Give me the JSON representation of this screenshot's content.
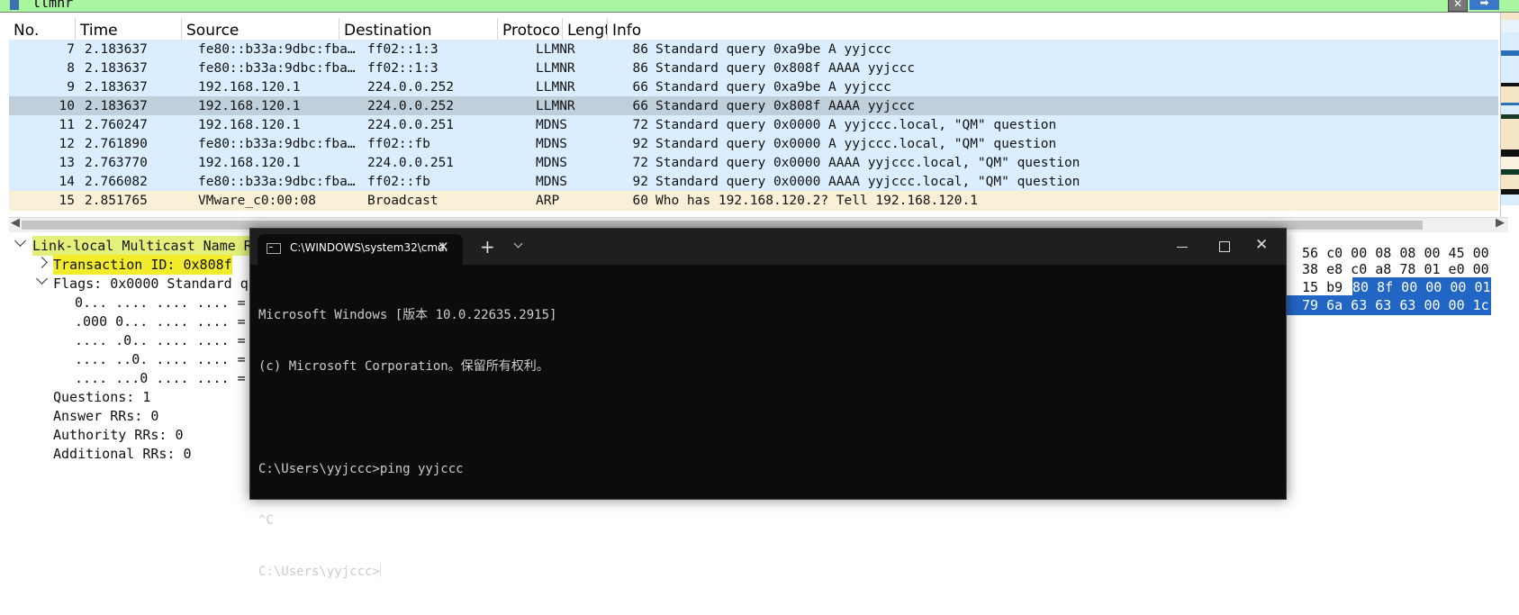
{
  "filter": {
    "text": "llmnr"
  },
  "packet_list": {
    "columns": [
      "No.",
      "Time",
      "Source",
      "Destination",
      "Protoco",
      "Lengt",
      "Info"
    ],
    "rows": [
      {
        "no": "7",
        "time": "2.183637",
        "src": "fe80::b33a:9dbc:fba…",
        "dst": "ff02::1:3",
        "proto": "LLMNR",
        "len": "86",
        "info": "Standard query 0xa9be A yyjccc"
      },
      {
        "no": "8",
        "time": "2.183637",
        "src": "fe80::b33a:9dbc:fba…",
        "dst": "ff02::1:3",
        "proto": "LLMNR",
        "len": "86",
        "info": "Standard query 0x808f AAAA yyjccc"
      },
      {
        "no": "9",
        "time": "2.183637",
        "src": "192.168.120.1",
        "dst": "224.0.0.252",
        "proto": "LLMNR",
        "len": "66",
        "info": "Standard query 0xa9be A yyjccc"
      },
      {
        "no": "10",
        "time": "2.183637",
        "src": "192.168.120.1",
        "dst": "224.0.0.252",
        "proto": "LLMNR",
        "len": "66",
        "info": "Standard query 0x808f AAAA yyjccc"
      },
      {
        "no": "11",
        "time": "2.760247",
        "src": "192.168.120.1",
        "dst": "224.0.0.251",
        "proto": "MDNS",
        "len": "72",
        "info": "Standard query 0x0000 A yyjccc.local, \"QM\" question"
      },
      {
        "no": "12",
        "time": "2.761890",
        "src": "fe80::b33a:9dbc:fba…",
        "dst": "ff02::fb",
        "proto": "MDNS",
        "len": "92",
        "info": "Standard query 0x0000 A yyjccc.local, \"QM\" question"
      },
      {
        "no": "13",
        "time": "2.763770",
        "src": "192.168.120.1",
        "dst": "224.0.0.251",
        "proto": "MDNS",
        "len": "72",
        "info": "Standard query 0x0000 AAAA yyjccc.local, \"QM\" question"
      },
      {
        "no": "14",
        "time": "2.766082",
        "src": "fe80::b33a:9dbc:fba…",
        "dst": "ff02::fb",
        "proto": "MDNS",
        "len": "92",
        "info": "Standard query 0x0000 AAAA yyjccc.local, \"QM\" question"
      },
      {
        "no": "15",
        "time": "2.851765",
        "src": "VMware_c0:00:08",
        "dst": "Broadcast",
        "proto": "ARP",
        "len": "60",
        "info": "Who has 192.168.120.2? Tell 192.168.120.1"
      }
    ],
    "selected_row": "10",
    "colors": {
      "row_bg": "#daeeff",
      "selected_bg": "#c0cfdc",
      "arp_bg": "#faf0d7"
    }
  },
  "details": {
    "lines": [
      "Link-local Multicast Name R",
      "Transaction ID: 0x808f",
      "Flags: 0x0000 Standard q",
      "0... .... .... .... =",
      ".000 0... .... .... =",
      ".... .0.. .... .... =",
      ".... ..0. .... .... =",
      ".... ...0 .... .... =",
      "Questions: 1",
      "Answer RRs: 0",
      "Authority RRs: 0",
      "Additional RRs: 0"
    ]
  },
  "bytes": {
    "row1": "56 c0 00 08 08 00 45 00",
    "row2": "38 e8 c0 a8 78 01 e0 00",
    "row3_plain": "15 b9",
    "row3_sel": "80 8f 00 00 00 01",
    "row4_sel": "79 6a 63 63 63 00 00 1c"
  },
  "cmd": {
    "tab_title": "C:\\WINDOWS\\system32\\cmd.",
    "new_tab": "+",
    "lines": [
      "Microsoft Windows [版本 10.0.22635.2915]",
      "(c) Microsoft Corporation。保留所有权利。",
      "",
      "C:\\Users\\yyjccc>ping yyjccc",
      "^C",
      "C:\\Users\\yyjccc>"
    ]
  }
}
